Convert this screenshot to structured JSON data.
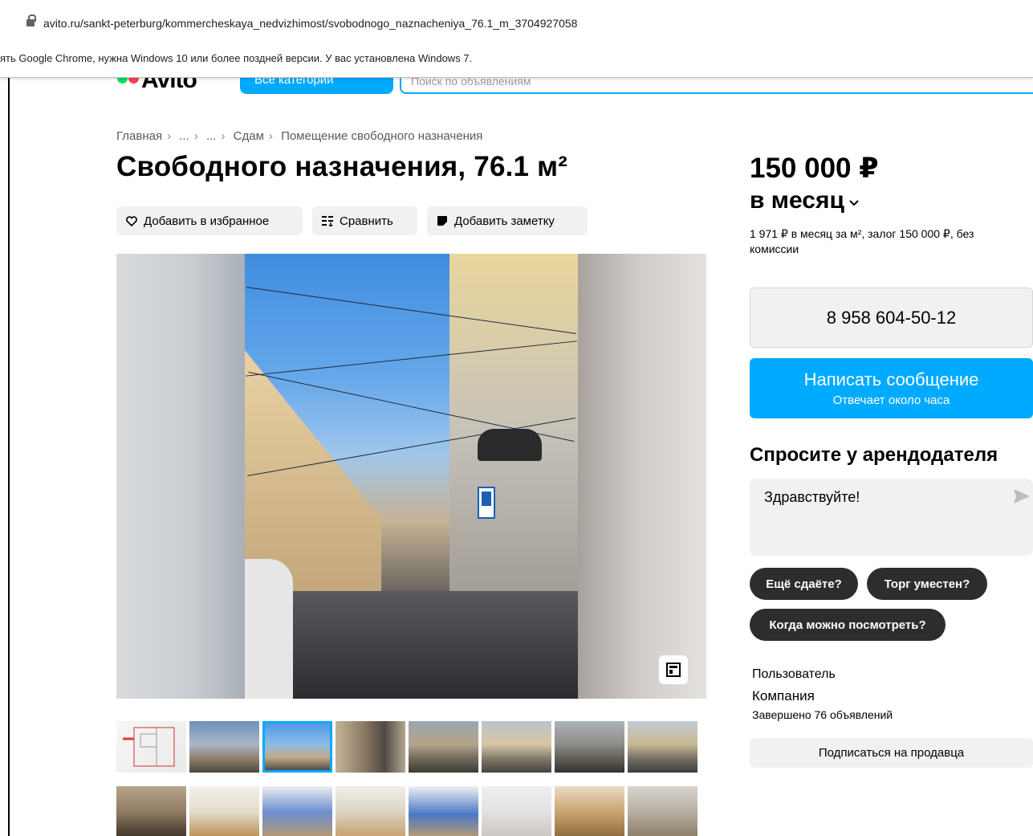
{
  "browser": {
    "url": "avito.ru/sankt-peterburg/kommercheskaya_nedvizhimost/svobodnogo_naznacheniya_76.1_m_3704927058",
    "infobar_message": "ять Google Chrome, нужна Windows 10 или более поздней версии. У вас установлена Windows 7."
  },
  "header": {
    "logo": "Avito",
    "categories_label": "Все категории",
    "search_placeholder": "Поиск по объявлениям"
  },
  "breadcrumbs": [
    "Главная",
    "...",
    "...",
    "Сдам",
    "Помещение свободного назначения"
  ],
  "breadcrumb_separator": "›",
  "title": "Свободного назначения, 76.1 м²",
  "actions": {
    "favorite": "Добавить в избранное",
    "compare": "Сравнить",
    "note": "Добавить заметку"
  },
  "gallery": {
    "thumbnail_count": 16,
    "selected_index": 2
  },
  "price": {
    "amount": "150 000 ₽",
    "period": "в месяц",
    "details": "1 971 ₽ в месяц за м², залог 150 000 ₽, без комиссии"
  },
  "contact": {
    "phone": "8 958 604-50-12",
    "message_label": "Написать сообщение",
    "message_sub": "Отвечает около часа"
  },
  "ask": {
    "title": "Спросите у арендодателя",
    "input_value": "Здравствуйте!",
    "chips": [
      "Ещё сдаёте?",
      "Торг уместен?",
      "Когда можно посмотреть?"
    ]
  },
  "seller": {
    "type": "Пользователь",
    "name": "Компания",
    "ads_completed": "Завершено 76 объявлений",
    "subscribe_label": "Подписаться на продавца"
  },
  "colors": {
    "accent_blue": "#00aaff",
    "button_gray": "#f2f1f0",
    "chip_dark": "#2d2d2d",
    "logo_green": "#04e061",
    "logo_red": "#ff4053"
  }
}
